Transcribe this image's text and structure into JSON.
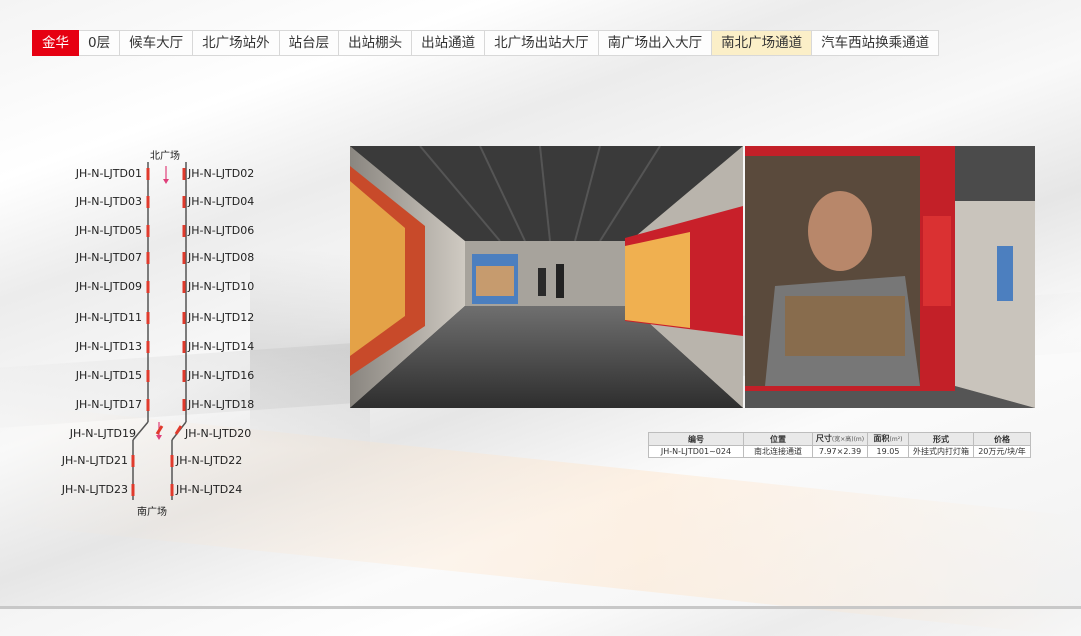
{
  "tabs": [
    {
      "label": "金华",
      "state": "active"
    },
    {
      "label": "0层",
      "state": ""
    },
    {
      "label": "候车大厅",
      "state": ""
    },
    {
      "label": "北广场站外",
      "state": ""
    },
    {
      "label": "站台层",
      "state": ""
    },
    {
      "label": "出站棚头",
      "state": ""
    },
    {
      "label": "出站通道",
      "state": ""
    },
    {
      "label": "北广场出站大厅",
      "state": ""
    },
    {
      "label": "南广场出入大厅",
      "state": ""
    },
    {
      "label": "南北广场通道",
      "state": "highlight"
    },
    {
      "label": "汽车西站换乘通道",
      "state": ""
    }
  ],
  "diagram": {
    "north_label": "北广场",
    "south_label": "南广场",
    "left_labels": [
      "JH-N-LJTD01",
      "JH-N-LJTD03",
      "JH-N-LJTD05",
      "JH-N-LJTD07",
      "JH-N-LJTD09",
      "JH-N-LJTD11",
      "JH-N-LJTD13",
      "JH-N-LJTD15",
      "JH-N-LJTD17",
      "JH-N-LJTD19",
      "JH-N-LJTD21",
      "JH-N-LJTD23"
    ],
    "right_labels": [
      "JH-N-LJTD02",
      "JH-N-LJTD04",
      "JH-N-LJTD06",
      "JH-N-LJTD08",
      "JH-N-LJTD10",
      "JH-N-LJTD12",
      "JH-N-LJTD14",
      "JH-N-LJTD16",
      "JH-N-LJTD18",
      "JH-N-LJTD20",
      "JH-N-LJTD22",
      "JH-N-LJTD24"
    ],
    "colors": {
      "wall": "#555555",
      "board": "#e03a2c",
      "arrow": "#e0407a"
    }
  },
  "table": {
    "headers": {
      "code": "编号",
      "location": "位置",
      "size": "尺寸",
      "size_unit": "(宽×高)(m)",
      "area": "面积",
      "area_unit": "(m²)",
      "form": "形式",
      "price": "价格"
    },
    "row": {
      "code": "JH-N-LJTD01~024",
      "location": "南北连接通道",
      "size": "7.97×2.39",
      "area": "19.05",
      "form": "外挂式内打灯箱",
      "price": "20万元/块/年"
    }
  }
}
